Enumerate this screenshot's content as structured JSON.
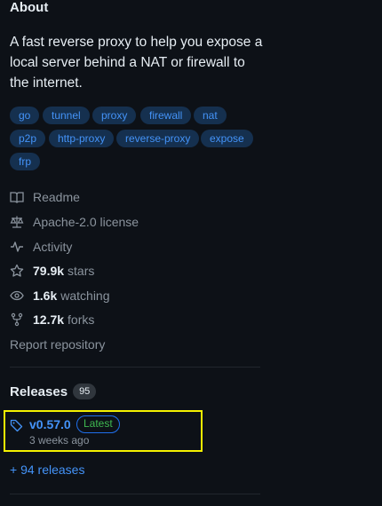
{
  "about": {
    "title": "About",
    "description": "A fast reverse proxy to help you expose a local server behind a NAT or firewall to the internet."
  },
  "topics": [
    "go",
    "tunnel",
    "proxy",
    "firewall",
    "nat",
    "p2p",
    "http-proxy",
    "reverse-proxy",
    "expose",
    "frp"
  ],
  "meta": {
    "readme": "Readme",
    "license": "Apache-2.0 license",
    "activity": "Activity",
    "stars_count": "79.9k",
    "stars_label": "stars",
    "watching_count": "1.6k",
    "watching_label": "watching",
    "forks_count": "12.7k",
    "forks_label": "forks",
    "report": "Report repository"
  },
  "releases": {
    "title": "Releases",
    "count": "95",
    "latest_version": "v0.57.0",
    "latest_badge": "Latest",
    "latest_date": "3 weeks ago",
    "more_link": "+ 94 releases"
  },
  "colors": {
    "background": "#0d1117",
    "link": "#4493f8",
    "muted": "#8b949e",
    "highlight": "#f5f200"
  }
}
